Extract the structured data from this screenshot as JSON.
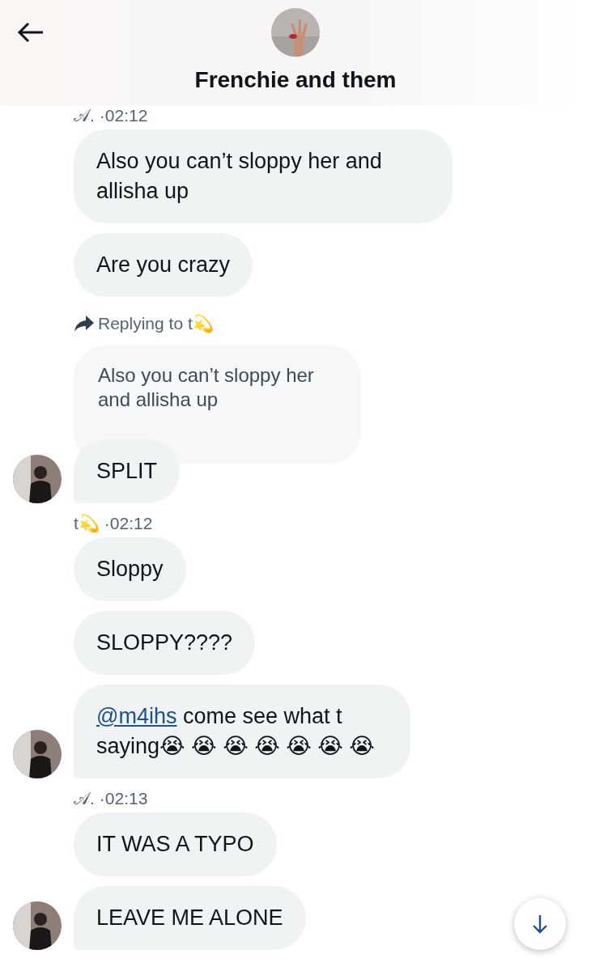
{
  "header": {
    "title": "Frenchie and them"
  },
  "messages": [
    {
      "kind": "meta",
      "sender": "𝒜.",
      "time": "·02:12"
    },
    {
      "kind": "bubble",
      "text": "Also you can’t sloppy her and allisha up",
      "avatar": false
    },
    {
      "kind": "bubble",
      "text": "Are you crazy",
      "avatar": false
    },
    {
      "kind": "reply",
      "label": "Replying to t💫",
      "quote": "Also you can’t sloppy her and allisha up"
    },
    {
      "kind": "bubble",
      "text": "SPLIT",
      "avatar": true
    },
    {
      "kind": "meta",
      "sender": "t💫",
      "time": "·02:12"
    },
    {
      "kind": "bubble",
      "text": "Sloppy",
      "avatar": false
    },
    {
      "kind": "bubble",
      "text": "SLOPPY????",
      "avatar": false
    },
    {
      "kind": "bubble",
      "mention": "@m4ihs",
      "text": " come see what t saying😭 😭 😭 😭 😭 😭 😭",
      "avatar": true
    },
    {
      "kind": "meta",
      "sender": "𝒜.",
      "time": "·02:13"
    },
    {
      "kind": "bubble",
      "text": "IT WAS A TYPO",
      "avatar": false
    },
    {
      "kind": "bubble",
      "text": "LEAVE ME ALONE",
      "avatar": true
    }
  ]
}
